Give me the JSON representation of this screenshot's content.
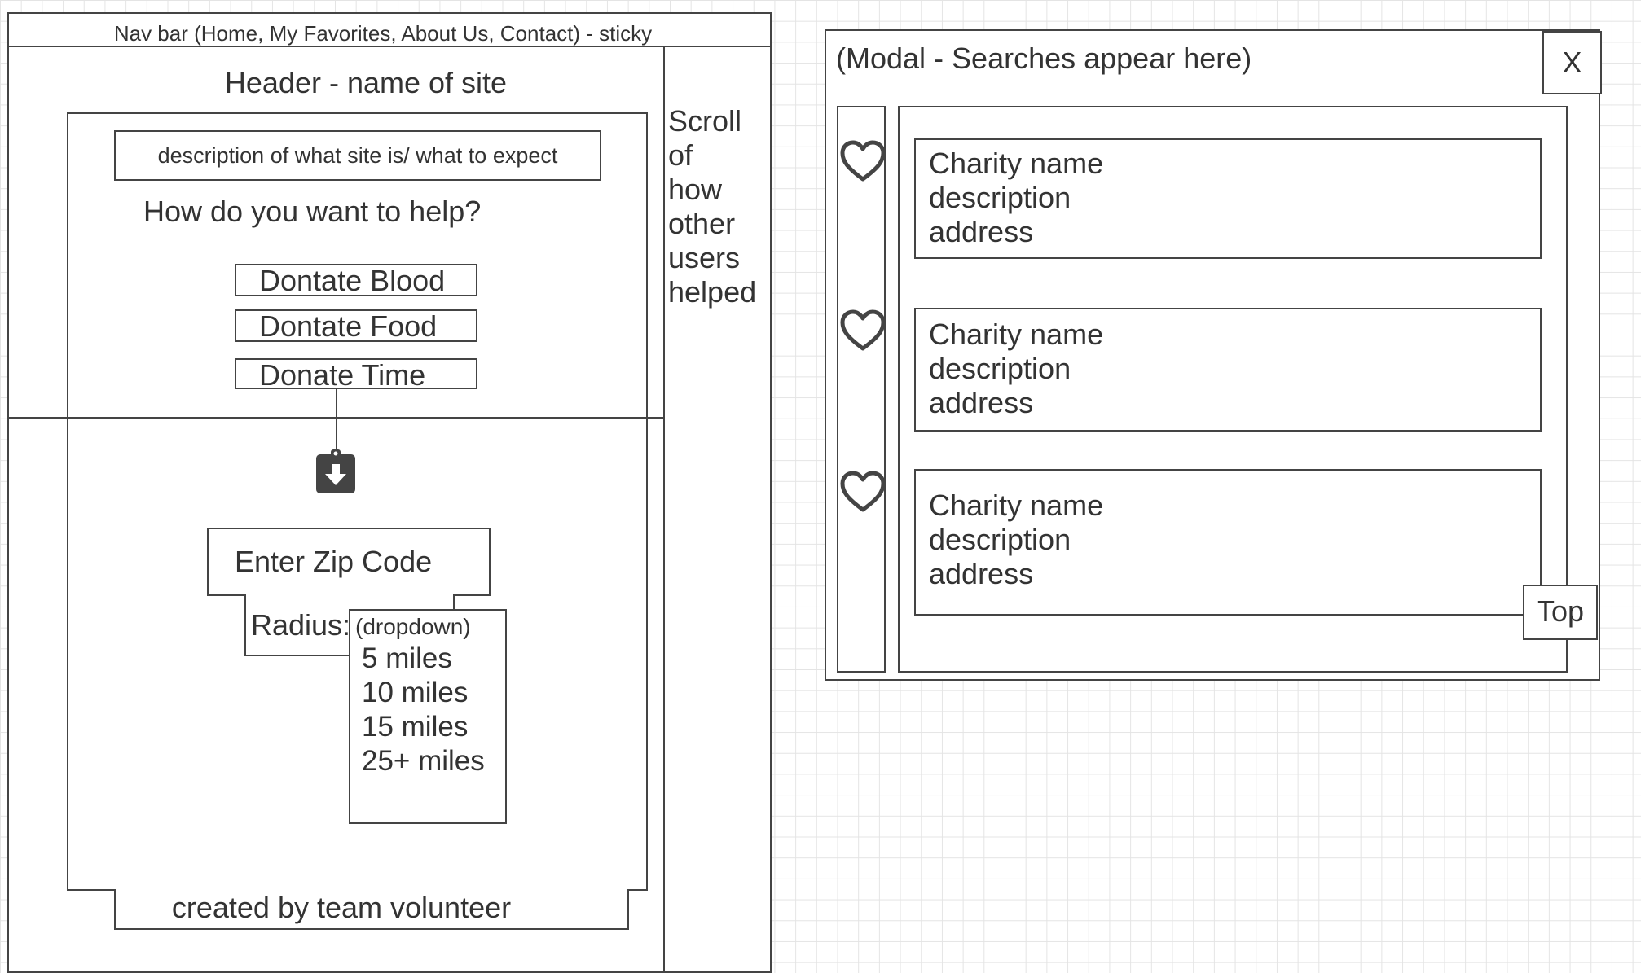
{
  "wireframe": {
    "nav_bar": "Nav bar (Home, My Favorites, About Us, Contact) - sticky",
    "header": "Header - name of site",
    "description": "description of what site is/ what to expect",
    "question": "How do you want to help?",
    "buttons": [
      "Dontate Blood",
      "Dontate Food",
      "Donate Time"
    ],
    "download_icon": "clipboard-down-arrow-icon",
    "zip_code_placeholder": "Enter Zip Code",
    "radius_label": "Radius:",
    "dropdown": {
      "label": "(dropdown)",
      "options": [
        "5 miles",
        "10 miles",
        "15 miles",
        "25+ miles"
      ]
    },
    "footer": "created by team volunteer",
    "sidebar_lines": [
      "Scroll",
      "of",
      "how",
      "other",
      "users",
      "helped"
    ]
  },
  "modal": {
    "title": "(Modal - Searches appear here)",
    "close_label": "X",
    "top_button": "Top",
    "favorite_icon": "heart-icon",
    "results": [
      {
        "name": "Charity name",
        "description": "description",
        "address": "address"
      },
      {
        "name": "Charity name",
        "description": "description",
        "address": "address"
      },
      {
        "name": "Charity name",
        "description": "description",
        "address": "address"
      }
    ]
  }
}
